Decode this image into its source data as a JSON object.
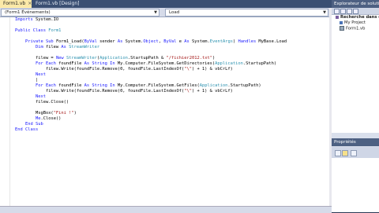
{
  "tabs": [
    {
      "label": "Form1.vb",
      "close": "×",
      "active": true
    },
    {
      "label": "Form1.vb [Design]",
      "close": "",
      "active": false
    }
  ],
  "dropdowns": {
    "left": "(Form1 Événements)",
    "right": "Load"
  },
  "code_lines": [
    [
      {
        "t": "Imports",
        "c": "kw"
      },
      {
        "t": " System.IO",
        "c": ""
      }
    ],
    [],
    [
      {
        "t": "Public Class ",
        "c": "kw"
      },
      {
        "t": "Form1",
        "c": "ty"
      }
    ],
    [],
    [
      {
        "t": "    Private Sub ",
        "c": "kw"
      },
      {
        "t": "Form1_Load(",
        "c": ""
      },
      {
        "t": "ByVal",
        "c": "kw"
      },
      {
        "t": " sender ",
        "c": ""
      },
      {
        "t": "As",
        "c": "kw"
      },
      {
        "t": " System.",
        "c": ""
      },
      {
        "t": "Object",
        "c": "kw"
      },
      {
        "t": ", ",
        "c": ""
      },
      {
        "t": "ByVal",
        "c": "kw"
      },
      {
        "t": " e ",
        "c": ""
      },
      {
        "t": "As",
        "c": "kw"
      },
      {
        "t": " System.",
        "c": ""
      },
      {
        "t": "EventArgs",
        "c": "ty"
      },
      {
        "t": ") ",
        "c": ""
      },
      {
        "t": "Handles",
        "c": "kw"
      },
      {
        "t": " MyBase.Load",
        "c": ""
      }
    ],
    [
      {
        "t": "        Dim",
        "c": "kw"
      },
      {
        "t": " filew ",
        "c": ""
      },
      {
        "t": "As",
        "c": "kw"
      },
      {
        "t": " ",
        "c": ""
      },
      {
        "t": "StreamWriter",
        "c": "ty"
      }
    ],
    [],
    [
      {
        "t": "        filew = ",
        "c": ""
      },
      {
        "t": "New",
        "c": "kw"
      },
      {
        "t": " ",
        "c": ""
      },
      {
        "t": "StreamWriter",
        "c": "ty"
      },
      {
        "t": "(",
        "c": ""
      },
      {
        "t": "Application",
        "c": "ty"
      },
      {
        "t": ".StartupPath & ",
        "c": ""
      },
      {
        "t": "\"/fichier2012.txt\"",
        "c": "str"
      },
      {
        "t": ")",
        "c": ""
      }
    ],
    [
      {
        "t": "        For Each",
        "c": "kw"
      },
      {
        "t": " foundFile ",
        "c": ""
      },
      {
        "t": "As String In",
        "c": "kw"
      },
      {
        "t": " My.Computer.FileSystem.GetDirectories(",
        "c": ""
      },
      {
        "t": "Application",
        "c": "ty"
      },
      {
        "t": ".StartupPath)",
        "c": ""
      }
    ],
    [
      {
        "t": "            filew.Write(foundFile.Remove(0, foundFile.LastIndexOf(",
        "c": ""
      },
      {
        "t": "\"\\\"",
        "c": "str"
      },
      {
        "t": ") + 1) & vbCrLf)",
        "c": ""
      }
    ],
    [
      {
        "t": "        Next",
        "c": "kw"
      }
    ],
    [
      {
        "t": "        |",
        "c": ""
      }
    ],
    [
      {
        "t": "        For Each",
        "c": "kw"
      },
      {
        "t": " foundFile ",
        "c": ""
      },
      {
        "t": "As String In",
        "c": "kw"
      },
      {
        "t": " My.Computer.FileSystem.GetFiles(",
        "c": ""
      },
      {
        "t": "Application",
        "c": "ty"
      },
      {
        "t": ".StartupPath)",
        "c": ""
      }
    ],
    [
      {
        "t": "            filew.Write(foundFile.Remove(0, foundFile.LastIndexOf(",
        "c": ""
      },
      {
        "t": "\"\\\"",
        "c": "str"
      },
      {
        "t": ") + 1) & vbCrLf)",
        "c": ""
      }
    ],
    [
      {
        "t": "        Next",
        "c": "kw"
      }
    ],
    [
      {
        "t": "        filew.Close()",
        "c": ""
      }
    ],
    [],
    [
      {
        "t": "        MsgBox(",
        "c": ""
      },
      {
        "t": "\"Fini !\"",
        "c": "str"
      },
      {
        "t": ")",
        "c": ""
      }
    ],
    [
      {
        "t": "        Me",
        "c": "kw"
      },
      {
        "t": ".Close()",
        "c": ""
      }
    ],
    [
      {
        "t": "    End Sub",
        "c": "kw"
      }
    ],
    [
      {
        "t": "End Class",
        "c": "kw"
      }
    ]
  ],
  "solution_explorer": {
    "title": "Explorateur de solutions",
    "items": [
      {
        "label": "Recherche dans d",
        "icon": "solution-icon",
        "bold": true,
        "indent": 1
      },
      {
        "label": "My Project",
        "icon": "project-icon",
        "bold": false,
        "indent": 2
      },
      {
        "label": "Form1.vb",
        "icon": "file-icon",
        "bold": false,
        "indent": 2
      }
    ]
  },
  "properties": {
    "title": "Propriétés"
  },
  "colors": {
    "keyword": "#1a1aff",
    "type": "#2b91af",
    "string": "#a31515",
    "active_tab": "#fbe9a8",
    "panel_title": "#4d6082"
  }
}
